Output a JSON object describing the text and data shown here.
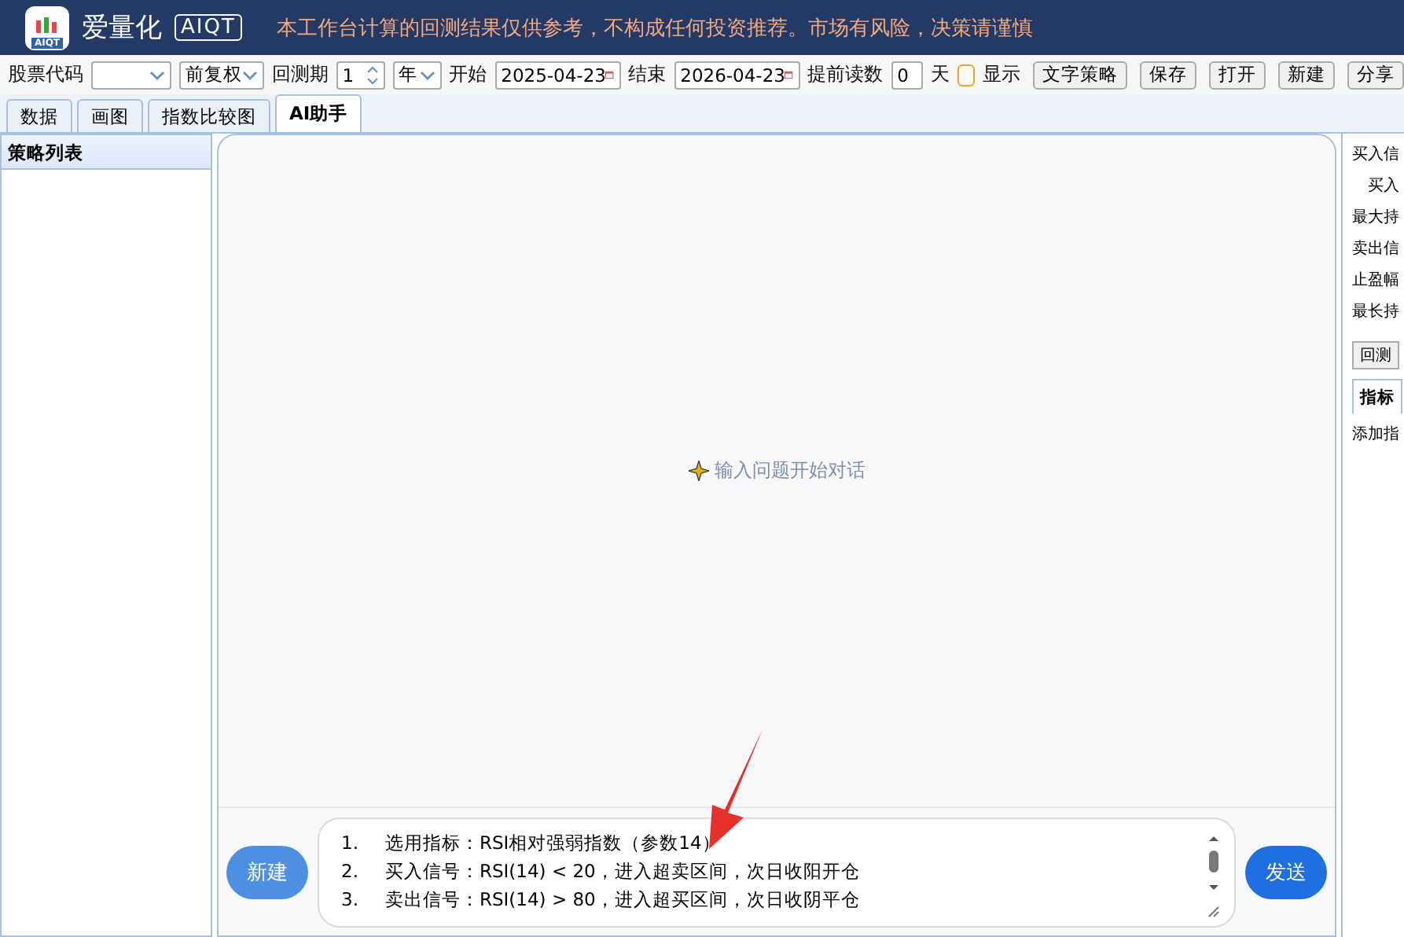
{
  "header": {
    "brand": "爱量化",
    "badge": "AIQT",
    "logo_caption": "AIQT",
    "notice": "本工作台计算的回测结果仅供参考，不构成任何投资推荐。市场有风险，决策请谨慎"
  },
  "toolbar": {
    "stock_label": "股票代码",
    "adjust": "前复权",
    "period_label": "回测期",
    "period_value": "1",
    "period_unit": "年",
    "start_label": "开始",
    "start_date": "2025-04-23",
    "end_label": "结束",
    "end_date": "2026-04-23",
    "preread_label": "提前读数",
    "preread_value": "0",
    "preread_unit": "天",
    "show_label": "显示",
    "show_checked": false,
    "buttons": [
      "文字策略",
      "保存",
      "打开",
      "新建",
      "分享"
    ]
  },
  "tabs": [
    {
      "label": "数据",
      "selected": false
    },
    {
      "label": "画图",
      "selected": false
    },
    {
      "label": "指数比较图",
      "selected": false
    },
    {
      "label": "AI助手",
      "selected": true
    }
  ],
  "sidebar": {
    "title": "策略列表"
  },
  "chat": {
    "empty_hint": "输入问题开始对话",
    "new_button": "新建",
    "send_button": "发送",
    "input_lines": [
      {
        "number": "1.",
        "text": "选用指标：RSI相对强弱指数（参数14）"
      },
      {
        "number": "2.",
        "text": "买入信号：RSI(14) < 20，进入超卖区间，次日收阳开仓"
      },
      {
        "number": "3.",
        "text": "卖出信号：RSI(14) > 80，进入超买区间，次日收阴平仓"
      }
    ]
  },
  "right_panel": {
    "rows": [
      "买入信",
      "买入",
      "最大持",
      "卖出信",
      "止盈幅",
      "最长持"
    ],
    "button": "回测",
    "tabs": [
      {
        "label": "指标",
        "selected": true
      }
    ],
    "content": "添加指"
  }
}
